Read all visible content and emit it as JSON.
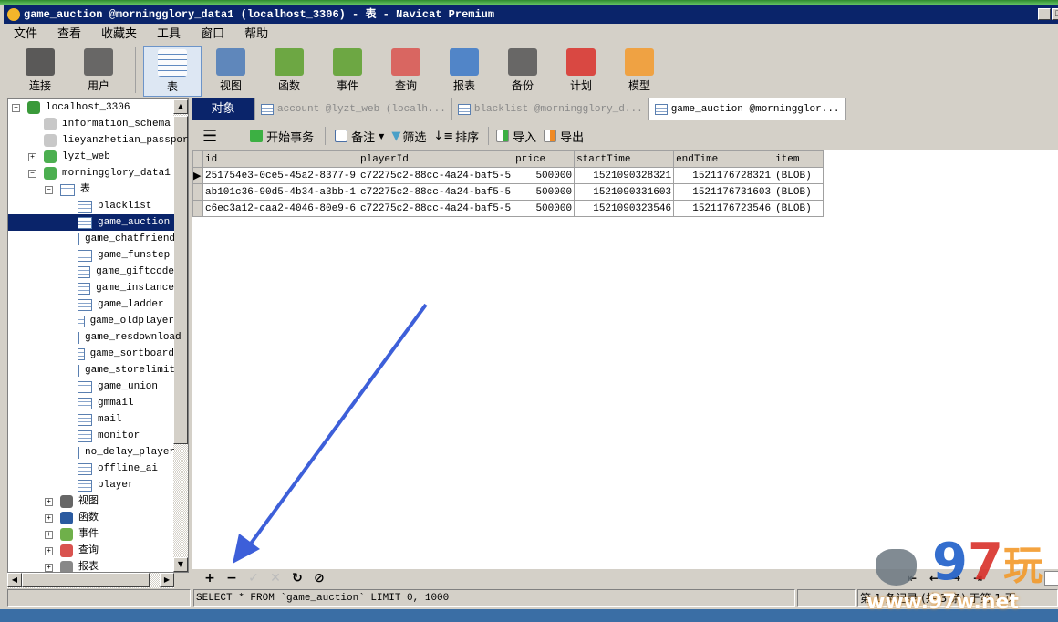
{
  "window": {
    "title": "game_auction @morningglory_data1 (localhost_3306) - 表 - Navicat Premium"
  },
  "menu": [
    "文件",
    "查看",
    "收藏夹",
    "工具",
    "窗口",
    "帮助"
  ],
  "toolbar": [
    {
      "label": "连接",
      "icon": "plug-server-icon"
    },
    {
      "label": "用户",
      "icon": "user-icon"
    },
    {
      "label": "表",
      "icon": "table-icon",
      "selected": true
    },
    {
      "label": "视图",
      "icon": "view-glasses-icon"
    },
    {
      "label": "函数",
      "icon": "function-icon"
    },
    {
      "label": "事件",
      "icon": "event-clock-icon"
    },
    {
      "label": "查询",
      "icon": "query-icon"
    },
    {
      "label": "报表",
      "icon": "report-icon"
    },
    {
      "label": "备份",
      "icon": "backup-tape-icon"
    },
    {
      "label": "计划",
      "icon": "schedule-calendar-icon"
    },
    {
      "label": "模型",
      "icon": "model-icon"
    }
  ],
  "tree": [
    {
      "label": "localhost_3306",
      "level": 0,
      "toggle": "−",
      "icon": "connection"
    },
    {
      "label": "information_schema",
      "level": 1,
      "icon": "db-gray"
    },
    {
      "label": "lieyanzhetian_passport",
      "level": 1,
      "icon": "db-gray"
    },
    {
      "label": "lyzt_web",
      "level": 1,
      "toggle": "+",
      "icon": "db-green"
    },
    {
      "label": "morningglory_data1",
      "level": 1,
      "toggle": "−",
      "icon": "db-green"
    },
    {
      "label": "表",
      "level": 2,
      "toggle": "−",
      "icon": "table"
    },
    {
      "label": "blacklist",
      "level": 3,
      "icon": "table"
    },
    {
      "label": "game_auction",
      "level": 3,
      "icon": "table",
      "selected": true
    },
    {
      "label": "game_chatfriend",
      "level": 3,
      "icon": "table"
    },
    {
      "label": "game_funstep",
      "level": 3,
      "icon": "table"
    },
    {
      "label": "game_giftcode",
      "level": 3,
      "icon": "table"
    },
    {
      "label": "game_instance",
      "level": 3,
      "icon": "table"
    },
    {
      "label": "game_ladder",
      "level": 3,
      "icon": "table"
    },
    {
      "label": "game_oldplayer",
      "level": 3,
      "icon": "table"
    },
    {
      "label": "game_resdownload",
      "level": 3,
      "icon": "table"
    },
    {
      "label": "game_sortboard",
      "level": 3,
      "icon": "table"
    },
    {
      "label": "game_storelimit",
      "level": 3,
      "icon": "table"
    },
    {
      "label": "game_union",
      "level": 3,
      "icon": "table"
    },
    {
      "label": "gmmail",
      "level": 3,
      "icon": "table"
    },
    {
      "label": "mail",
      "level": 3,
      "icon": "table"
    },
    {
      "label": "monitor",
      "level": 3,
      "icon": "table"
    },
    {
      "label": "no_delay_player",
      "level": 3,
      "icon": "table"
    },
    {
      "label": "offline_ai",
      "level": 3,
      "icon": "table"
    },
    {
      "label": "player",
      "level": 3,
      "icon": "table"
    },
    {
      "label": "视图",
      "level": 2,
      "toggle": "+",
      "icon": "view"
    },
    {
      "label": "函数",
      "level": 2,
      "toggle": "+",
      "icon": "function"
    },
    {
      "label": "事件",
      "level": 2,
      "toggle": "+",
      "icon": "event"
    },
    {
      "label": "查询",
      "level": 2,
      "toggle": "+",
      "icon": "query"
    },
    {
      "label": "报表",
      "level": 2,
      "toggle": "+",
      "icon": "report"
    }
  ],
  "tabs": [
    {
      "label": "对象"
    },
    {
      "label": "account @lyzt_web (localh..."
    },
    {
      "label": "blacklist @morningglory_d..."
    },
    {
      "label": "game_auction @morningglor...",
      "active": true
    }
  ],
  "grid_toolbar": {
    "begin_tx": "开始事务",
    "memo": "备注",
    "filter": "筛选",
    "sort": "排序",
    "import": "导入",
    "export": "导出"
  },
  "table": {
    "columns": [
      "id",
      "playerId",
      "price",
      "startTime",
      "endTime",
      "item"
    ],
    "rows": [
      [
        "251754e3-0ce5-45a2-8377-9",
        "c72275c2-88cc-4a24-baf5-5",
        "500000",
        "1521090328321",
        "1521176728321",
        "(BLOB)"
      ],
      [
        "ab101c36-90d5-4b34-a3bb-1",
        "c72275c2-88cc-4a24-baf5-5",
        "500000",
        "1521090331603",
        "1521176731603",
        "(BLOB)"
      ],
      [
        "c6ec3a12-caa2-4046-80e9-6",
        "c72275c2-88cc-4a24-baf5-5",
        "500000",
        "1521090323546",
        "1521176723546",
        "(BLOB)"
      ]
    ]
  },
  "bottom_toolbar": {
    "add": "+",
    "delete": "−",
    "apply": "✓",
    "cancel": "✕",
    "refresh": "↻",
    "stop": "⊘"
  },
  "status": {
    "sql": "SELECT * FROM `game_auction` LIMIT 0, 1000",
    "records": "第 1 条记录 (共 3 条) 于第 1 页"
  },
  "watermark": {
    "logo": "97玩",
    "url": "www.97w.net"
  },
  "colors": {
    "titlebar": "#0a246a",
    "selection": "#0a246a",
    "arrow": "#3d5fd9"
  }
}
